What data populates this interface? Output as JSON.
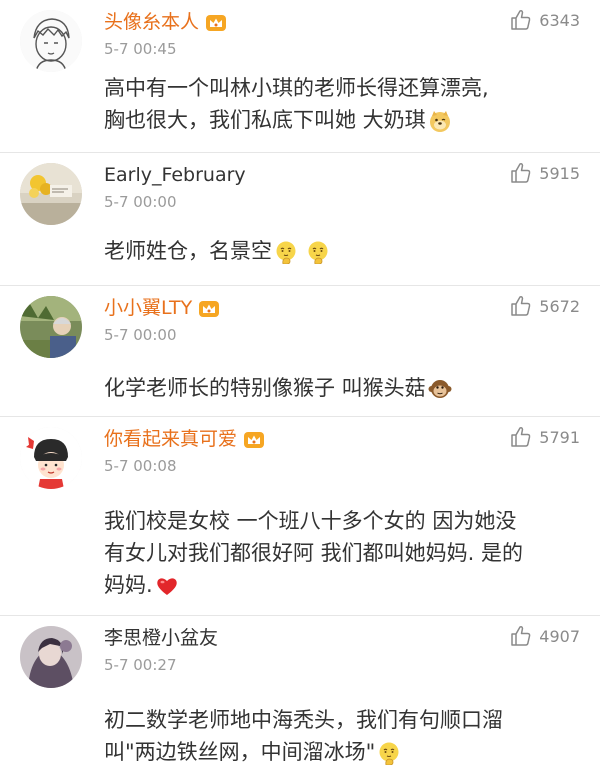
{
  "comments": [
    {
      "username": "头像糸本人",
      "time": "5-7 00:45",
      "likes": "6343",
      "text_lines": [
        "高中有一个叫林小琪的老师长得还算漂亮,",
        "胸也很大，我们私底下叫她 大奶琪"
      ],
      "vip": true,
      "emoji": [
        "doge-emoji"
      ]
    },
    {
      "username": "Early_February",
      "time": "5-7 00:00",
      "likes": "5915",
      "text_lines": [
        "老师姓仓，名景空"
      ],
      "vip": false,
      "emoji": [
        "thinking-emoji",
        "thinking-emoji"
      ]
    },
    {
      "username": "小小翼LTY",
      "time": "5-7 00:00",
      "likes": "5672",
      "text_lines": [
        "化学老师长的特别像猴子 叫猴头菇"
      ],
      "vip": true,
      "emoji": [
        "monkey-emoji"
      ]
    },
    {
      "username": "你看起来真可爱",
      "time": "5-7 00:08",
      "likes": "5791",
      "text_lines": [
        "我们校是女校 一个班八十多个女的 因为她没",
        "有女儿对我们都很好阿 我们都叫她妈妈. 是的",
        "妈妈."
      ],
      "vip": true,
      "emoji": [
        "heart-emoji"
      ]
    },
    {
      "username": "李思橙小盆友",
      "time": "5-7 00:27",
      "likes": "4907",
      "text_lines": [
        "初二数学老师地中海秃头，我们有句顺口溜",
        "叫\"两边铁丝网，中间溜冰场\""
      ],
      "vip": false,
      "emoji": [
        "thinking-emoji"
      ]
    }
  ],
  "colors": {
    "vip_name": "#e8711c",
    "plain_name": "#333333",
    "time": "#9b9b9b",
    "divider": "#e6e6e6"
  }
}
